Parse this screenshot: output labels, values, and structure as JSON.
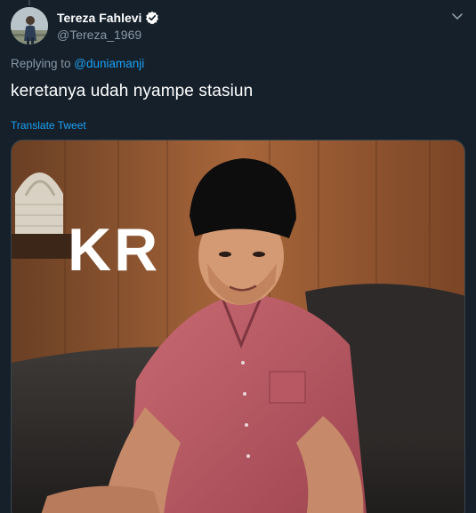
{
  "author": {
    "display_name": "Tereza Fahlevi",
    "handle": "@Tereza_1969",
    "verified": true
  },
  "reply": {
    "prefix": "Replying to ",
    "mention": "@duniamanji"
  },
  "tweet": {
    "text": "keretanya udah nyampe stasiun",
    "translate_label": "Translate Tweet"
  },
  "media": {
    "overlay_text": "KR"
  },
  "icons": {
    "caret": "chevron-down-icon",
    "verified": "verified-badge-icon"
  },
  "colors": {
    "background": "#15202b",
    "link": "#1da1f2",
    "secondary_text": "#8899a6",
    "border": "#38444d"
  }
}
